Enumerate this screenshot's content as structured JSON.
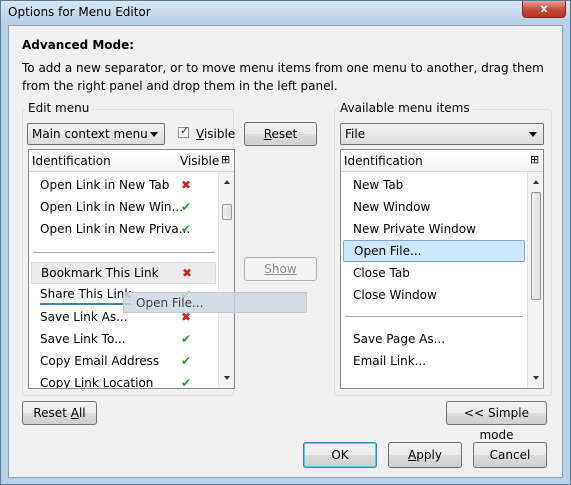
{
  "window": {
    "title": "Options for Menu Editor",
    "close_glyph": "x"
  },
  "intro": {
    "heading": "Advanced Mode:",
    "description": "To add a new separator, or to move menu items from one menu to another, drag them from the right panel and drop them in the left panel."
  },
  "edit_menu": {
    "legend": "Edit menu",
    "menu_select": "Main context menu",
    "visible_label": "Visible",
    "visible_checked": true,
    "reset_label": "Reset",
    "col_identification": "Identification",
    "col_visible": "Visible",
    "items": [
      {
        "label": "Open Link in New Tab",
        "visible": false
      },
      {
        "label": "Open Link in New Win...",
        "visible": true
      },
      {
        "label": "Open Link in New Priva...",
        "visible": true
      },
      {
        "label": "Bookmark This Link",
        "visible": false
      },
      {
        "label": "Share This Link",
        "visible": true
      },
      {
        "label": "Save Link As...",
        "visible": false
      },
      {
        "label": "Save Link To...",
        "visible": true
      },
      {
        "label": "Copy Email Address",
        "visible": true
      },
      {
        "label": "Copy Link Location",
        "visible": true
      }
    ]
  },
  "show_button": "Show",
  "drag_ghost": "Open File...",
  "available": {
    "legend": "Available menu items",
    "select": "File",
    "col_identification": "Identification",
    "items": [
      "New Tab",
      "New Window",
      "New Private Window",
      "Open File...",
      "Close Tab",
      "Close Window",
      "Save Page As...",
      "Email Link..."
    ],
    "selected": "Open File..."
  },
  "footer": {
    "reset_all": "Reset All",
    "simple_mode": "<< Simple mode",
    "ok": "OK",
    "apply": "Apply",
    "cancel": "Cancel"
  },
  "colors": {
    "accent_selection": "#cce8ff",
    "visible_check": "#1e9a2a",
    "hidden_x": "#d02020"
  }
}
